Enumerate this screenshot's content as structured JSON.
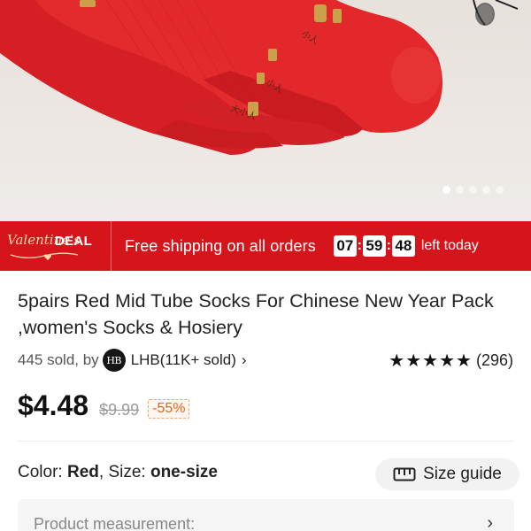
{
  "hero": {
    "carousel_count": 5,
    "carousel_active": 1
  },
  "deal": {
    "logo_script": "Valentine's",
    "logo_word": "DEAL",
    "text": "Free shipping on all orders",
    "timer": {
      "hours": "07",
      "minutes": "59",
      "seconds": "48"
    },
    "timer_suffix": "left today"
  },
  "product": {
    "title": "5pairs Red Mid Tube Socks For Chinese New Year Pack ,women's Socks & Hosiery",
    "sold": "445 sold, by",
    "store_avatar": "HB",
    "store": "LHB(11K+ sold)",
    "rating_stars": 4.5,
    "reviews": "(296)",
    "price": "$4.48",
    "original_price": "$9.99",
    "discount": "-55%"
  },
  "options": {
    "color_label": "Color:",
    "color_value": "Red",
    "size_label": "Size:",
    "size_value": "one-size",
    "size_guide": "Size guide"
  },
  "measurement": {
    "label": "Product measurement:"
  },
  "colors": {
    "deal_red": "#d5141c",
    "sock_red": "#e02427",
    "discount_orange": "#e8621a"
  }
}
